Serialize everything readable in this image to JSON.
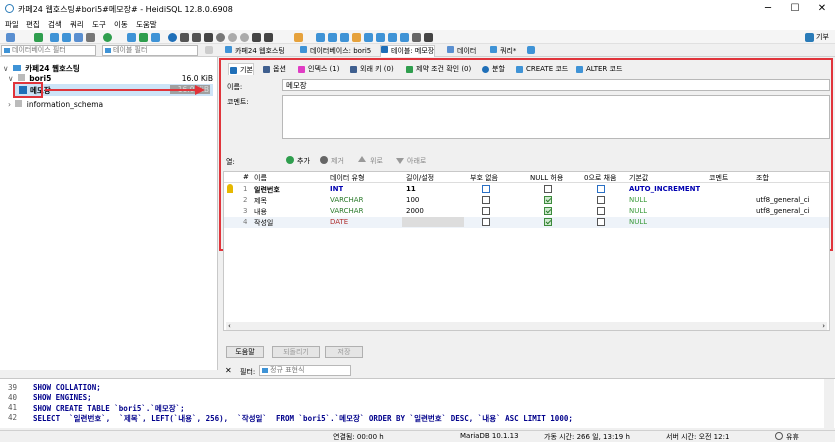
{
  "window": {
    "title": "카페24 웹호스팅#bori5#메모장# - HeidiSQL 12.8.0.6908",
    "minimize": "─",
    "maximize": "☐",
    "close": "✕"
  },
  "menu": [
    "파일",
    "편집",
    "검색",
    "쿼리",
    "도구",
    "이동",
    "도움말"
  ],
  "toolbar": {
    "donate": "기부"
  },
  "filters": {
    "db_filter_placeholder": "데이터베이스 필터",
    "table_filter_placeholder": "테이블 필터"
  },
  "main_tabs": [
    "카페24 웹호스팅",
    "데이터베이스: bori5",
    "테이블: 메모장",
    "데이터",
    "쿼리*"
  ],
  "tree": {
    "server": "카페24 웹호스팅",
    "db": "bori5",
    "db_size": "16.0 KiB",
    "table": "메모장",
    "table_size": "16.0 KiB",
    "schema": "information_schema"
  },
  "subtabs": [
    "기본",
    "옵션",
    "인덱스 (1)",
    "외래 키 (0)",
    "제약 조건 확인 (0)",
    "분할",
    "CREATE 코드",
    "ALTER 코드"
  ],
  "form": {
    "name_label": "이름:",
    "name_value": "메모장",
    "comment_label": "코멘트:"
  },
  "columns_toolbar": {
    "label": "열:",
    "add": "추가",
    "remove": "제거",
    "up": "위로",
    "down": "아래로"
  },
  "grid": {
    "headers": [
      "#",
      "이름",
      "데이터 유형",
      "길이/설정",
      "부호 없음",
      "NULL 허용",
      "0으로 채움",
      "기본값",
      "코멘트",
      "조합"
    ],
    "rows": [
      {
        "num": "1",
        "name": "일련번호",
        "type": "INT",
        "length": "11",
        "unsigned": false,
        "nullable": false,
        "zerofill": false,
        "default": "AUTO_INCREMENT",
        "comment": "",
        "collation": "",
        "key": true
      },
      {
        "num": "2",
        "name": "제목",
        "type": "VARCHAR",
        "length": "100",
        "unsigned": false,
        "nullable": true,
        "zerofill": false,
        "default": "NULL",
        "comment": "",
        "collation": "utf8_general_ci",
        "key": false
      },
      {
        "num": "3",
        "name": "내용",
        "type": "VARCHAR",
        "length": "2000",
        "unsigned": false,
        "nullable": true,
        "zerofill": false,
        "default": "NULL",
        "comment": "",
        "collation": "utf8_general_ci",
        "key": false
      },
      {
        "num": "4",
        "name": "작성일",
        "type": "DATE",
        "length": "",
        "unsigned": false,
        "nullable": true,
        "zerofill": false,
        "default": "NULL",
        "comment": "",
        "collation": "",
        "key": false
      }
    ]
  },
  "buttons": {
    "help": "도움말",
    "discard": "되돌리기",
    "save": "저장"
  },
  "filterbar": {
    "close": "✕",
    "label": "필터:",
    "placeholder": "정규 표현식"
  },
  "sql": [
    {
      "n": "39",
      "t": "SHOW COLLATION;"
    },
    {
      "n": "40",
      "t": "SHOW ENGINES;"
    },
    {
      "n": "41",
      "t": "SHOW CREATE TABLE `bori5`.`메모장`;"
    },
    {
      "n": "42",
      "t": "SELECT  `일련번호`,  `제목`, LEFT(`내용`, 256),  `작성일`  FROM `bori5`.`메모장` ORDER BY `일련번호` DESC, `내용` ASC LIMIT 1000;"
    }
  ],
  "status": {
    "connected": "연결됨: 00:00 h",
    "server": "MariaDB 10.1.13",
    "uptime": "가동 시간: 266 일, 13:19 h",
    "server_time": "서버 시간: 오전 12:1",
    "idle": "유휴"
  },
  "colors": {
    "accent": "#e0343b",
    "brand": "#3f93d6"
  }
}
